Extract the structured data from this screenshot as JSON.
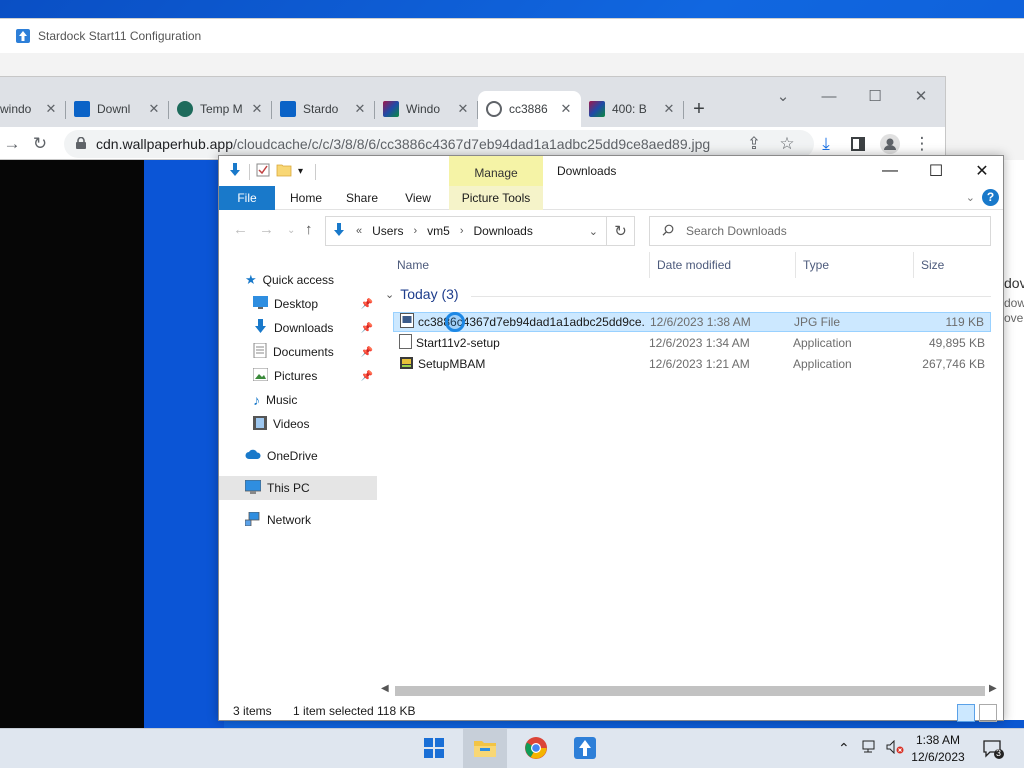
{
  "stardock": {
    "title": "Stardock Start11 Configuration"
  },
  "chrome": {
    "tabs": [
      {
        "label": "windo",
        "icon": "windows-icon"
      },
      {
        "label": "Downl",
        "icon": "stardock-icon"
      },
      {
        "label": "Temp M",
        "icon": "temp-mail-icon"
      },
      {
        "label": "Stardo",
        "icon": "stardock-icon"
      },
      {
        "label": "Windo",
        "icon": "windows-icon"
      },
      {
        "label": "cc3886",
        "icon": "globe-icon"
      },
      {
        "label": "400: B",
        "icon": "windows-icon"
      }
    ],
    "active_tab_index": 5,
    "url_host": "cdn.wallpaperhub.app",
    "url_path": "/cloudcache/c/c/3/8/8/6/cc3886c4367d7eb94dad1a1adbc25dd9ce8aed89.jpg"
  },
  "explorer": {
    "title": "Downloads",
    "manage_label": "Manage",
    "ribbon_tabs": [
      "File",
      "Home",
      "Share",
      "View"
    ],
    "picture_tools": "Picture Tools",
    "breadcrumb": [
      "Users",
      "vm5",
      "Downloads"
    ],
    "breadcrumb_prefix": "«",
    "search_placeholder": "Search Downloads",
    "nav": {
      "quick_access": "Quick access",
      "desktop": "Desktop",
      "downloads": "Downloads",
      "documents": "Documents",
      "pictures": "Pictures",
      "music": "Music",
      "videos": "Videos",
      "onedrive": "OneDrive",
      "this_pc": "This PC",
      "network": "Network"
    },
    "columns": {
      "name": "Name",
      "date": "Date modified",
      "type": "Type",
      "size": "Size"
    },
    "group_label": "Today (3)",
    "files": [
      {
        "name": "cc3886c4367d7eb94dad1a1adbc25dd9ce...",
        "date": "12/6/2023 1:38 AM",
        "type": "JPG File",
        "size": "119 KB"
      },
      {
        "name": "Start11v2-setup",
        "date": "12/6/2023 1:34 AM",
        "type": "Application",
        "size": "49,895 KB"
      },
      {
        "name": "SetupMBAM",
        "date": "12/6/2023 1:21 AM",
        "type": "Application",
        "size": "267,746 KB"
      }
    ],
    "status": {
      "items": "3 items",
      "selected": "1 item selected",
      "size": "118 KB"
    }
  },
  "page_bg": {
    "lines": [
      "dov",
      "dow",
      "ove"
    ]
  },
  "taskbar": {
    "time": "1:38 AM",
    "date": "12/6/2023",
    "notifications": "3"
  }
}
